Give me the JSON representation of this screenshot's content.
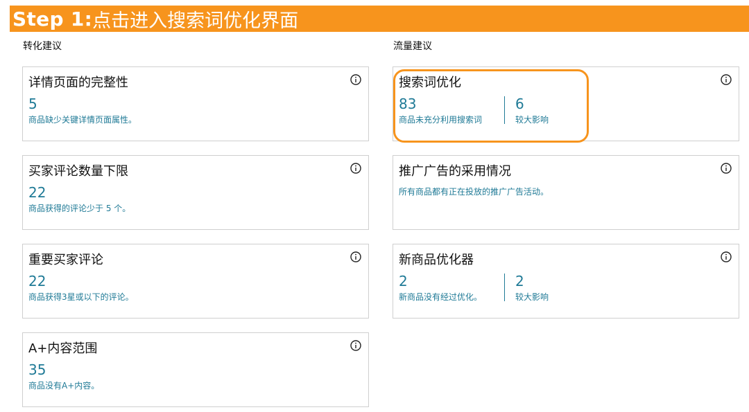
{
  "banner": {
    "step_label": "Step 1:",
    "text": "点击进入搜索词优化界面"
  },
  "sections": {
    "conversion_title": "转化建议",
    "traffic_title": "流量建议"
  },
  "conversion_cards": [
    {
      "title": "详情页面的完整性",
      "value": "5",
      "desc": "商品缺少关键详情页面属性。"
    },
    {
      "title": "买家评论数量下限",
      "value": "22",
      "desc": "商品获得的评论少于 5 个。"
    },
    {
      "title": "重要买家评论",
      "value": "22",
      "desc": "商品获得3星或以下的评论。"
    },
    {
      "title": "A+内容范围",
      "value": "35",
      "desc": "商品没有A+内容。"
    }
  ],
  "traffic_cards": [
    {
      "title": "搜索词优化",
      "value1": "83",
      "desc1": "商品未充分利用搜索词",
      "value2": "6",
      "desc2": "较大影响"
    },
    {
      "title": "推广广告的采用情况",
      "desc": "所有商品都有正在投放的推广广告活动。"
    },
    {
      "title": "新商品优化器",
      "value1": "2",
      "desc1": "新商品没有经过优化。",
      "value2": "2",
      "desc2": "较大影响"
    }
  ],
  "icons": {
    "info": "info-circle-icon"
  },
  "colors": {
    "banner": "#F7941D",
    "highlight": "#F7941D",
    "value_text": "#1f7a96",
    "card_border": "#cfcfcf"
  }
}
